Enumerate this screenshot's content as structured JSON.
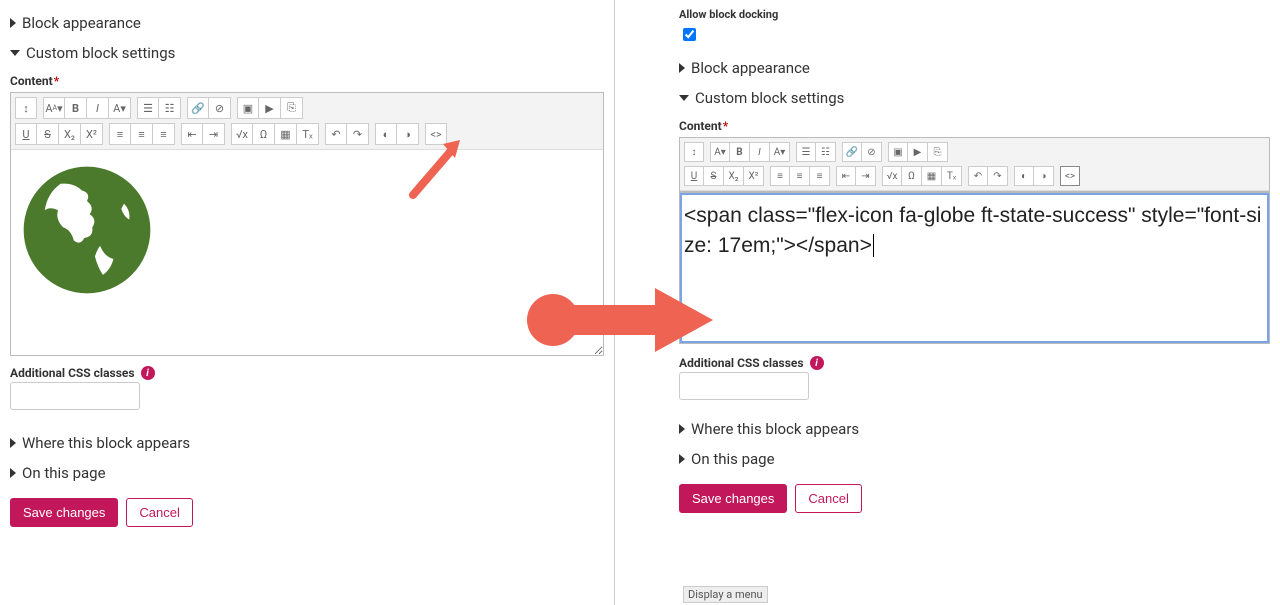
{
  "left": {
    "sections": {
      "block_appearance": "Block appearance",
      "custom_block_settings": "Custom block settings",
      "where_appears": "Where this block appears",
      "on_this_page": "On this page"
    },
    "content_label": "Content",
    "css_label": "Additional CSS classes",
    "css_value": "",
    "save": "Save changes",
    "cancel": "Cancel",
    "toolbar": {
      "toggle": "⤢",
      "font": "A",
      "bold": "B",
      "italic": "I",
      "fontfam": "A",
      "ul": "≣",
      "ol": "≣",
      "link": "⚯",
      "unlink": "⊘",
      "img": "▣",
      "media": "▶",
      "file": "⎘",
      "u": "U",
      "s": "S",
      "sub": "X₂",
      "sup": "X²",
      "al": "≡",
      "ac": "≡",
      "ar": "≡",
      "out": "⇤",
      "ind": "⇥",
      "eq": "√x",
      "omega": "Ω",
      "table": "▦",
      "clear": "Tₓ",
      "undo": "↶",
      "redo": "↷",
      "a1": "◐",
      "a2": "◑",
      "code": "<>"
    }
  },
  "right": {
    "allow_docking": "Allow block docking",
    "docking_checked": true,
    "sections": {
      "block_appearance": "Block appearance",
      "custom_block_settings": "Custom block settings",
      "where_appears": "Where this block appears",
      "on_this_page": "On this page"
    },
    "content_label": "Content",
    "css_label": "Additional CSS classes",
    "css_value": "",
    "save": "Save changes",
    "cancel": "Cancel",
    "code_content": "<span class=\"flex-icon fa-globe ft-state-success\" style=\"font-size: 17em;\"></span>",
    "footer_tip": "Display a menu"
  },
  "colors": {
    "accent": "#c2185b",
    "globe": "#4b7a2c",
    "arrow": "#ee6352"
  }
}
